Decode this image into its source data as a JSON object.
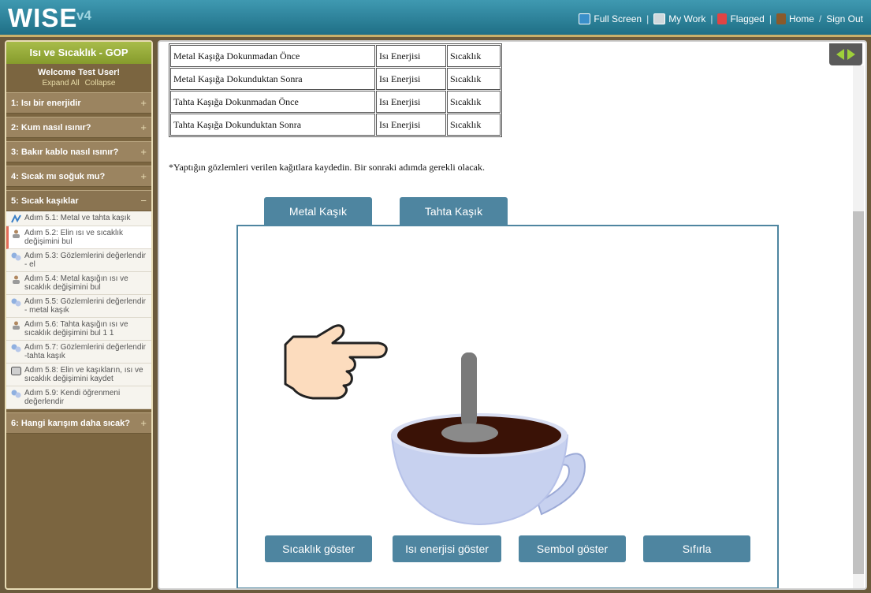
{
  "header": {
    "logo": "WISE",
    "version": "v4",
    "nav": {
      "fullscreen": "Full Screen",
      "mywork": "My Work",
      "flagged": "Flagged",
      "home": "Home",
      "signout": "Sign Out"
    }
  },
  "sidebar": {
    "title": "Isı ve Sıcaklık - GOP",
    "welcome": "Welcome Test User!",
    "expand_all": "Expand All",
    "collapse": "Collapse",
    "activities": [
      {
        "label": "1: Isı bir enerjidir"
      },
      {
        "label": "2: Kum nasıl ısınır?"
      },
      {
        "label": "3: Bakır kablo nasıl ısınır?"
      },
      {
        "label": "4: Sıcak mı soğuk mu?"
      },
      {
        "label": "5: Sıcak kaşıklar"
      }
    ],
    "steps": [
      {
        "label": "Adım 5.1: Metal ve tahta kaşık",
        "icon": "note-icon"
      },
      {
        "label": "Adım 5.2: Elin ısı ve sıcaklık değişimini bul",
        "icon": "person-icon"
      },
      {
        "label": "Adım 5.3: Gözlemlerini değerlendir - el",
        "icon": "chat-icon"
      },
      {
        "label": "Adım 5.4: Metal kaşığın ısı ve sıcaklık değişimini bul",
        "icon": "person-icon"
      },
      {
        "label": "Adım 5.5: Gözlemlerini değerlendir - metal kaşık",
        "icon": "chat-icon"
      },
      {
        "label": "Adım 5.6: Tahta kaşığın ısı ve sıcaklık değişimini bul 1 1",
        "icon": "person-icon"
      },
      {
        "label": "Adım 5.7: Gözlemlerini değerlendir -tahta kaşık",
        "icon": "chat-icon"
      },
      {
        "label": "Adım 5.8: Elin ve kaşıkların, ısı ve sıcaklık değişimini kaydet",
        "icon": "box-icon"
      },
      {
        "label": "Adım 5.9: Kendi öğrenmeni değerlendir",
        "icon": "chat-icon"
      }
    ],
    "last_activity": "6: Hangi karışım daha sıcak?"
  },
  "table": {
    "rows": [
      [
        "Metal Kaşığa Dokunmadan Önce",
        "Isı Enerjisi",
        "Sıcaklık"
      ],
      [
        "Metal Kaşığa Dokunduktan Sonra",
        "Isı Enerjisi",
        "Sıcaklık"
      ],
      [
        "Tahta Kaşığa Dokunmadan Önce",
        "Isı Enerjisi",
        "Sıcaklık"
      ],
      [
        "Tahta Kaşığa Dokunduktan Sonra",
        "Isı Enerjisi",
        "Sıcaklık"
      ]
    ]
  },
  "note": "*Yaptığın gözlemleri verilen kağıtlara kaydedin. Bir sonraki adımda gerekli olacak.",
  "sim": {
    "tabs": [
      "Metal Kaşık",
      "Tahta Kaşık"
    ],
    "buttons": [
      "Sıcaklık göster",
      "Isı enerjisi göster",
      "Sembol göster",
      "Sıfırla"
    ]
  },
  "colors": {
    "accent": "#4e85a0",
    "header": "#2a7d95",
    "sidebar": "#7b6540",
    "current_step": "#e36c5a"
  }
}
